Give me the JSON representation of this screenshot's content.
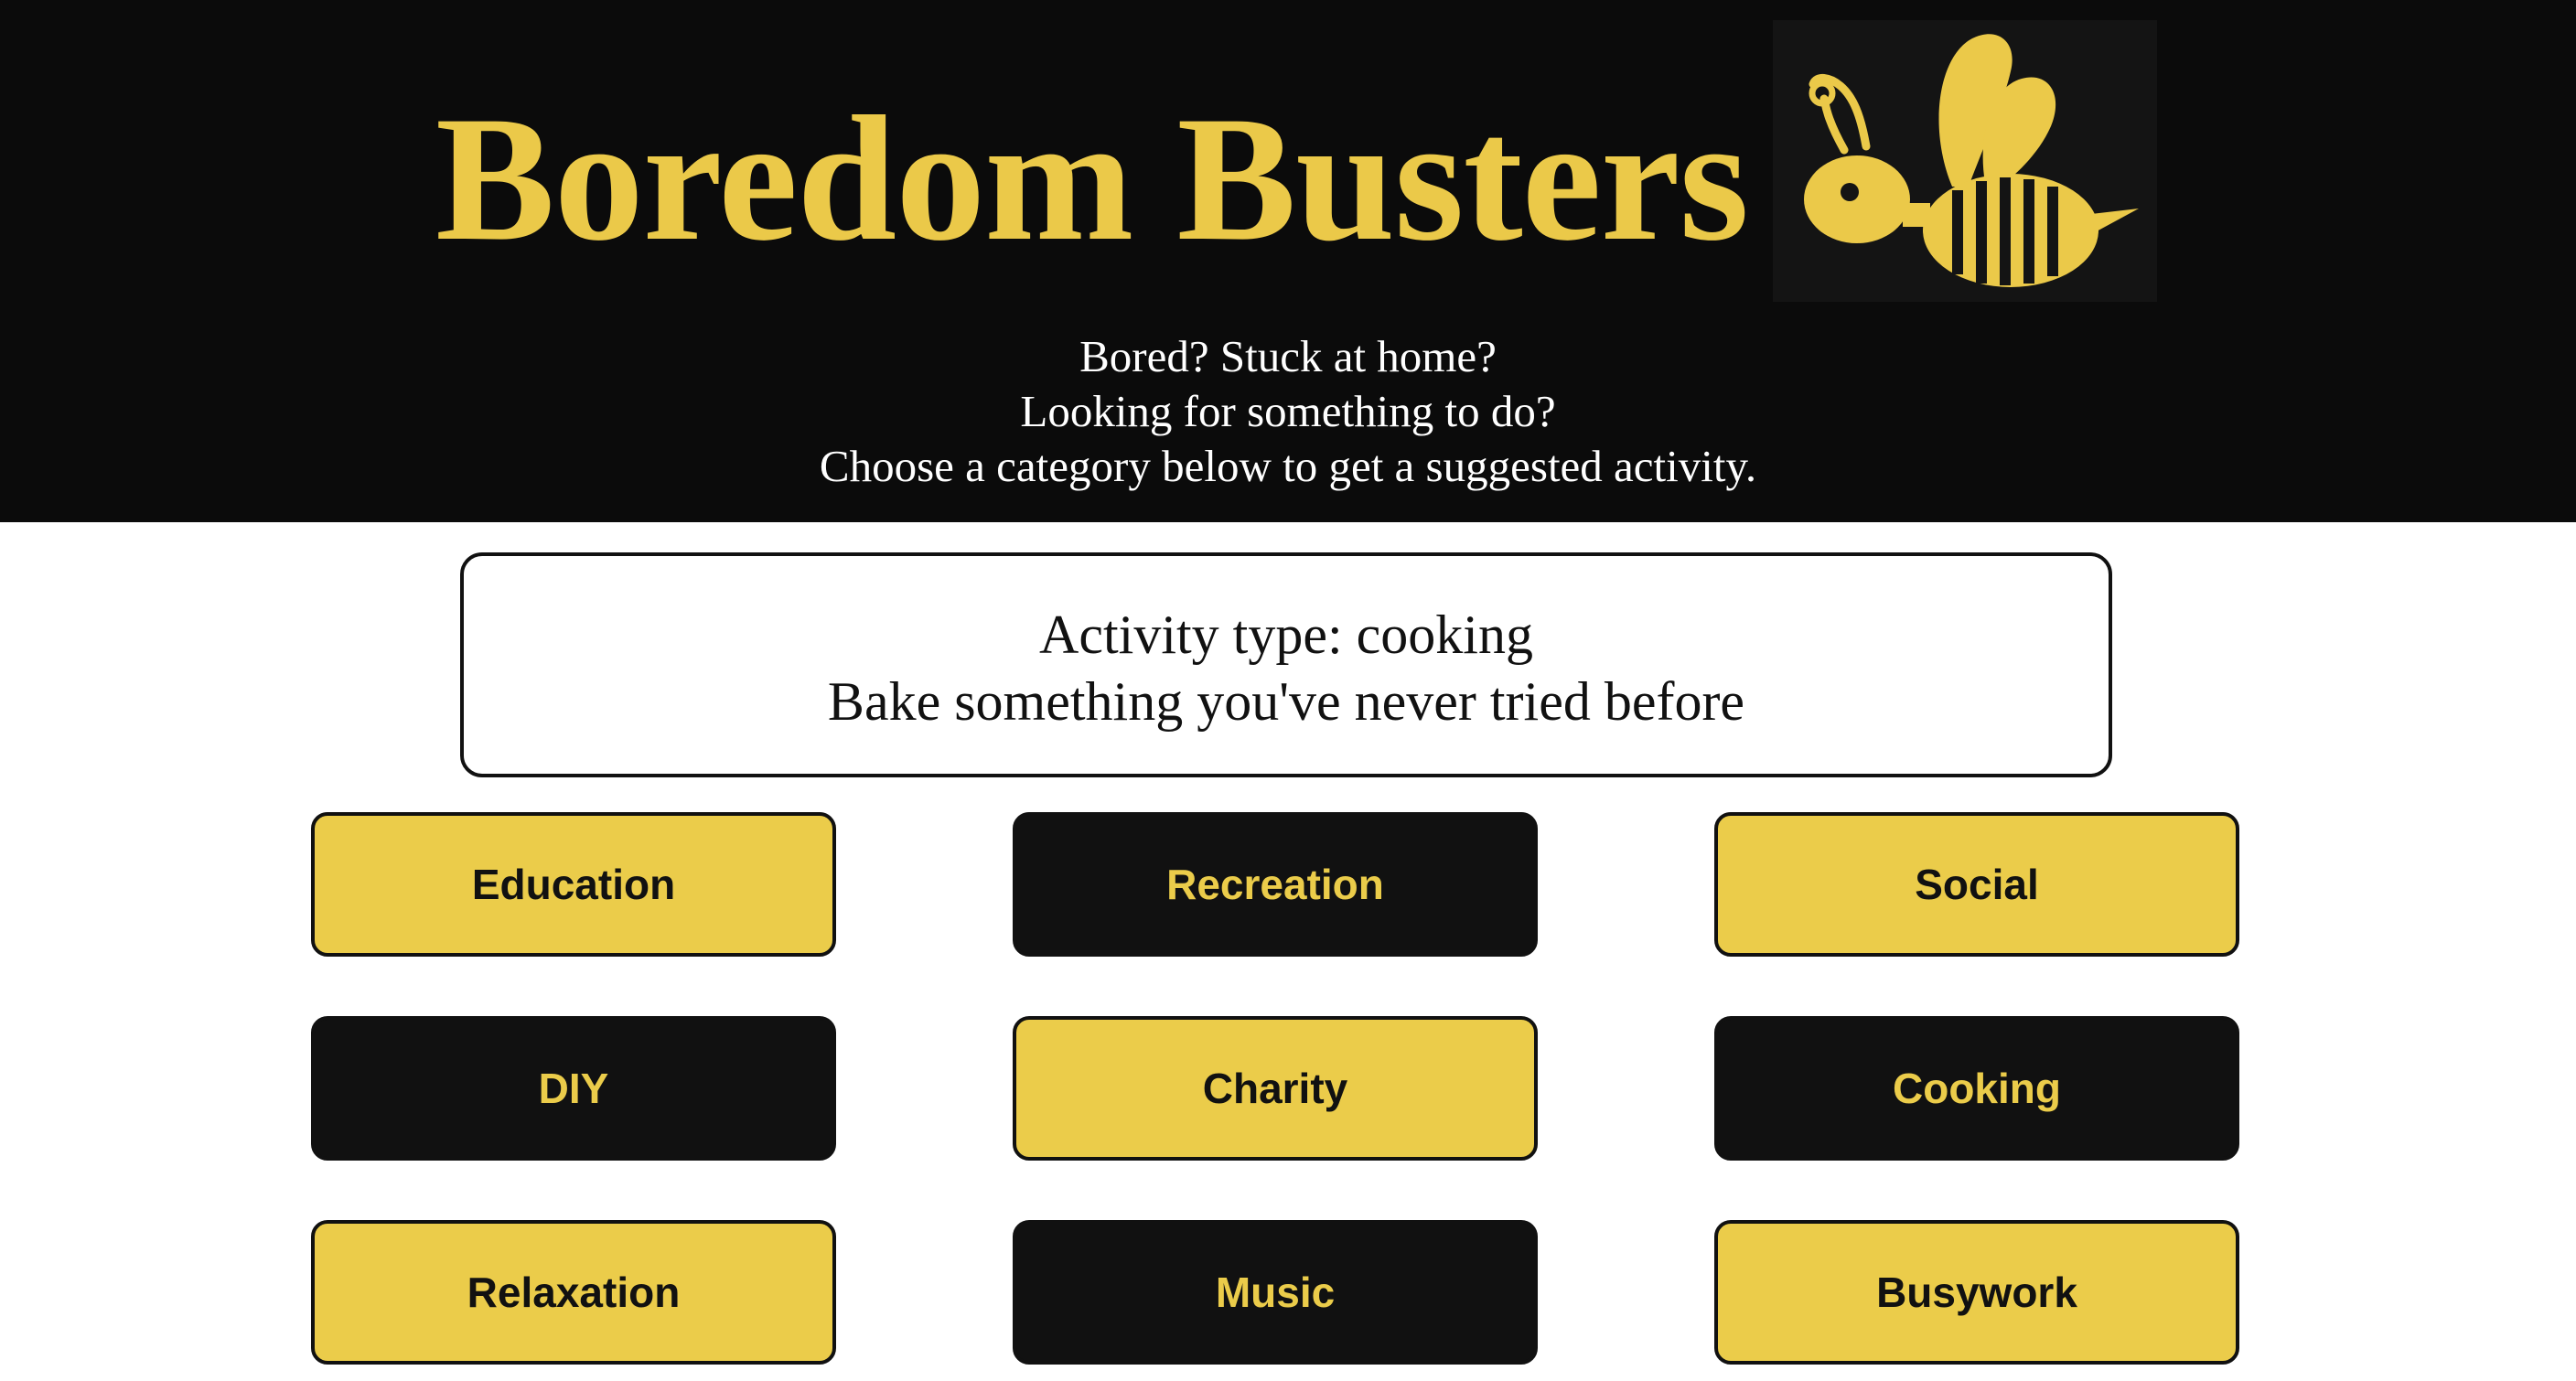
{
  "header": {
    "title": "Boredom Busters",
    "logo_icon": "bee-icon",
    "tagline": [
      "Bored? Stuck at home?",
      "Looking for something to do?",
      "Choose a category below to get a suggested activity."
    ]
  },
  "activity": {
    "type_line": "Activity type: cooking",
    "suggestion": "Bake something you've never tried before"
  },
  "categories": [
    {
      "label": "Education",
      "style": "yellow"
    },
    {
      "label": "Recreation",
      "style": "black"
    },
    {
      "label": "Social",
      "style": "yellow"
    },
    {
      "label": "DIY",
      "style": "black"
    },
    {
      "label": "Charity",
      "style": "yellow"
    },
    {
      "label": "Cooking",
      "style": "black"
    },
    {
      "label": "Relaxation",
      "style": "yellow"
    },
    {
      "label": "Music",
      "style": "black"
    },
    {
      "label": "Busywork",
      "style": "yellow"
    }
  ],
  "colors": {
    "accent_yellow": "#ebcc4a",
    "header_black": "#0b0b0b",
    "button_black": "#111111"
  }
}
